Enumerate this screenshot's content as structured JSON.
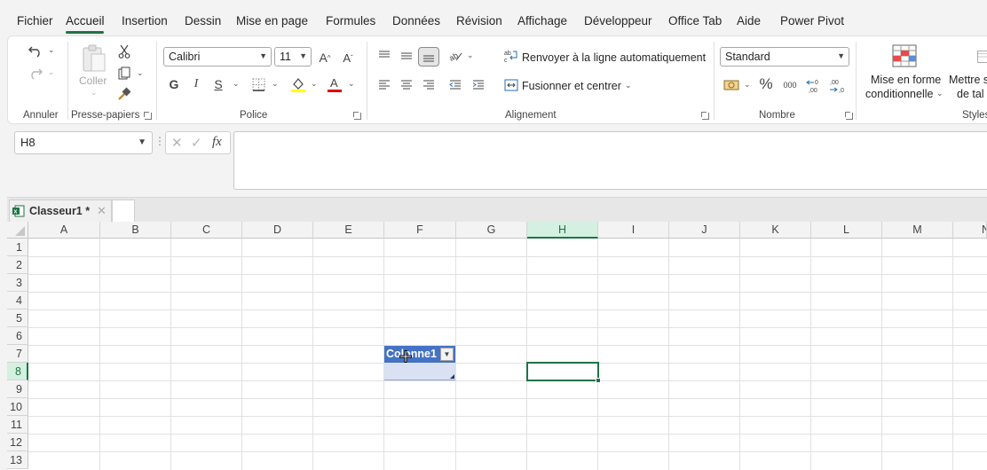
{
  "menu": {
    "items": [
      "Fichier",
      "Accueil",
      "Insertion",
      "Dessin",
      "Mise en page",
      "Formules",
      "Données",
      "Révision",
      "Affichage",
      "Développeur",
      "Office Tab",
      "Aide",
      "Power Pivot"
    ],
    "active": "Accueil"
  },
  "ribbon": {
    "groups": {
      "annuler": "Annuler",
      "presse_papiers": "Presse-papiers",
      "police": "Police",
      "alignement": "Alignement",
      "nombre": "Nombre",
      "styles": "Styles"
    },
    "coller_label": "Coller",
    "font_name": "Calibri",
    "font_size": "11",
    "bold": "G",
    "italic": "I",
    "underline": "S",
    "wrap_text": "Renvoyer à la ligne automatiquement",
    "merge_center": "Fusionner et centrer",
    "number_format": "Standard",
    "conditional_format_line1": "Mise en forme",
    "conditional_format_line2": "conditionnelle",
    "table_format_line1": "Mettre s",
    "table_format_line2": "de tal"
  },
  "formula_bar": {
    "name_box": "H8",
    "fx": "fx",
    "content": ""
  },
  "tabs": {
    "document": "Classeur1 *"
  },
  "sheet": {
    "columns": [
      "A",
      "B",
      "C",
      "D",
      "E",
      "F",
      "G",
      "H",
      "I",
      "J",
      "K",
      "L",
      "M",
      "N"
    ],
    "rows": [
      "1",
      "2",
      "3",
      "4",
      "5",
      "6",
      "7",
      "8",
      "9",
      "10",
      "11",
      "12",
      "13"
    ],
    "selected_column": "H",
    "selected_row": "8",
    "table_header": "Colonne1"
  },
  "colors": {
    "accent": "#217346",
    "table_header": "#4472c4",
    "table_row": "#d9e1f2"
  }
}
